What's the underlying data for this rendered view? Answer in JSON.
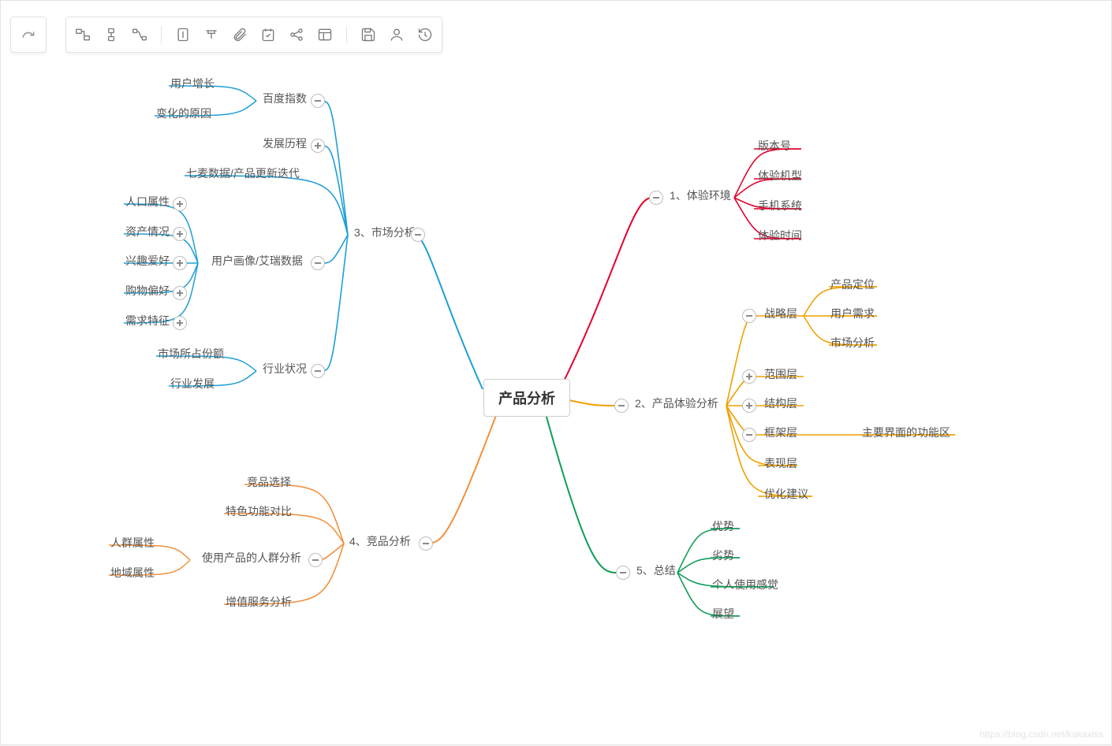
{
  "root": "产品分析",
  "watermark": "https://blog.csdn.net/kakaxiss",
  "colors": {
    "b1_red": "#e4002b",
    "b2_yellow": "#f0a000",
    "b3_blue": "#1e9fd6",
    "b4_orange": "#f2913d",
    "b5_green": "#0f9d58"
  },
  "branches": {
    "b1": {
      "label": "1、体验环境",
      "children": [
        "版本号",
        "体验机型",
        "手机系统",
        "体验时间"
      ]
    },
    "b2": {
      "label": "2、产品体验分析",
      "sub": {
        "s1": {
          "label": "战略层",
          "children": [
            "产品定位",
            "用户需求",
            "市场分析"
          ],
          "toggle": "minus"
        },
        "s2": {
          "label": "范围层",
          "toggle": "plus"
        },
        "s3": {
          "label": "结构层",
          "toggle": "plus"
        },
        "s4": {
          "label": "框架层",
          "children": [
            "主要界面的功能区"
          ],
          "toggle": "minus"
        },
        "s5": {
          "label": "表现层"
        },
        "s6": {
          "label": "优化建议"
        }
      }
    },
    "b5": {
      "label": "5、总结",
      "children": [
        "优势",
        "劣势",
        "个人使用感觉",
        "展望"
      ]
    },
    "b3": {
      "label": "3、市场分析",
      "sub": {
        "s1": {
          "label": "百度指数",
          "children": [
            "用户增长",
            "变化的原因"
          ],
          "toggle": "minus"
        },
        "s2": {
          "label": "发展历程",
          "toggle": "plus"
        },
        "s2b": {
          "label": "七麦数据/产品更新迭代"
        },
        "s3": {
          "label": "用户画像/艾瑞数据",
          "children": [
            "人口属性",
            "资产情况",
            "兴趣爱好",
            "购物偏好",
            "需求特征"
          ],
          "toggle": "minus",
          "child_toggle": "plus"
        },
        "s4": {
          "label": "行业状况",
          "children": [
            "市场所占份额",
            "行业发展"
          ],
          "toggle": "minus"
        }
      }
    },
    "b4": {
      "label": "4、竞品分析",
      "sub": {
        "s1": {
          "label": "竞品选择"
        },
        "s2": {
          "label": "特色功能对比"
        },
        "s3": {
          "label": "使用产品的人群分析",
          "children": [
            "人群属性",
            "地域属性"
          ],
          "toggle": "minus"
        },
        "s4": {
          "label": "增值服务分析"
        }
      }
    }
  }
}
